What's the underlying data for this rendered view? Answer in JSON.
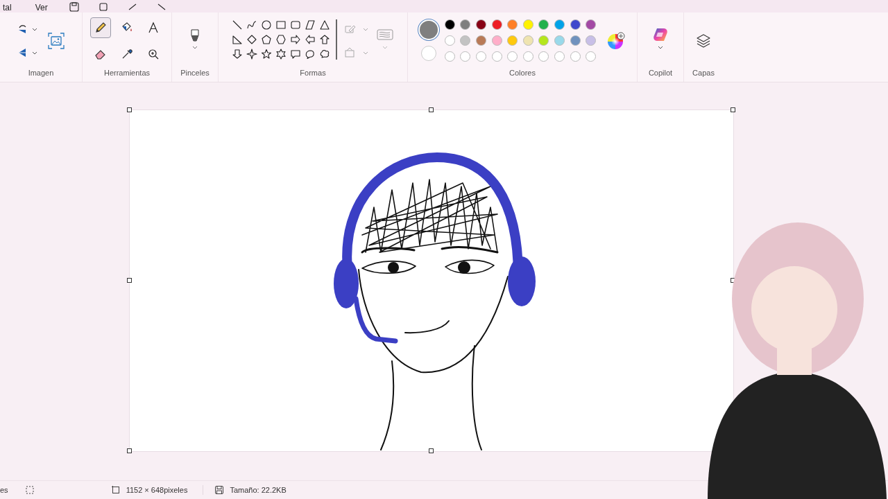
{
  "menu": [
    {
      "label": "tal"
    },
    {
      "label": "Ver"
    }
  ],
  "ribbon": {
    "image": {
      "label": "Imagen"
    },
    "tools": {
      "label": "Herramientas",
      "items": [
        {
          "kind": "pencil",
          "selected": true
        },
        {
          "kind": "fill",
          "selected": false
        },
        {
          "kind": "text",
          "selected": false
        },
        {
          "kind": "eraser",
          "selected": false
        },
        {
          "kind": "picker",
          "selected": false
        },
        {
          "kind": "zoom",
          "selected": false
        }
      ]
    },
    "brushes": {
      "label": "Pinceles"
    },
    "shapes": {
      "label": "Formas",
      "items": [
        {
          "kind": "line"
        },
        {
          "kind": "curve"
        },
        {
          "kind": "oval"
        },
        {
          "kind": "rect"
        },
        {
          "kind": "roundrect"
        },
        {
          "kind": "polygon"
        },
        {
          "kind": "triangle"
        },
        {
          "kind": "right-triangle"
        },
        {
          "kind": "diamond"
        },
        {
          "kind": "pentagon"
        },
        {
          "kind": "hexagon"
        },
        {
          "kind": "arrow-right"
        },
        {
          "kind": "arrow-left"
        },
        {
          "kind": "arrow-up"
        },
        {
          "kind": "arrow-down"
        },
        {
          "kind": "star4"
        },
        {
          "kind": "star5"
        },
        {
          "kind": "star6"
        },
        {
          "kind": "callout-rect"
        },
        {
          "kind": "callout-oval"
        },
        {
          "kind": "callout-cloud"
        }
      ]
    },
    "colors": {
      "label": "Colores",
      "current": [
        {
          "color": "#7f7f7f",
          "selected": true
        },
        {
          "color": "#ffffff",
          "selected": false
        }
      ],
      "palette": [
        {
          "kind": "swatch",
          "color": "#000000"
        },
        {
          "kind": "swatch",
          "color": "#7f7f7f"
        },
        {
          "kind": "swatch",
          "color": "#880015"
        },
        {
          "kind": "swatch",
          "color": "#ed1c24"
        },
        {
          "kind": "swatch",
          "color": "#ff7f27"
        },
        {
          "kind": "swatch",
          "color": "#fff200"
        },
        {
          "kind": "swatch",
          "color": "#22b14c"
        },
        {
          "kind": "swatch",
          "color": "#00a2e8"
        },
        {
          "kind": "swatch",
          "color": "#3f48cc"
        },
        {
          "kind": "swatch",
          "color": "#a349a4"
        },
        {
          "kind": "swatch",
          "color": "#ffffff"
        },
        {
          "kind": "swatch",
          "color": "#c3c3c3"
        },
        {
          "kind": "swatch",
          "color": "#b97a57"
        },
        {
          "kind": "swatch",
          "color": "#ffaec9"
        },
        {
          "kind": "swatch",
          "color": "#ffc90e"
        },
        {
          "kind": "swatch",
          "color": "#efe4b0"
        },
        {
          "kind": "swatch",
          "color": "#b5e61d"
        },
        {
          "kind": "swatch",
          "color": "#99d9ea"
        },
        {
          "kind": "swatch",
          "color": "#7092be"
        },
        {
          "kind": "swatch",
          "color": "#c8bfe7"
        },
        {
          "kind": "empty"
        },
        {
          "kind": "empty"
        },
        {
          "kind": "empty"
        },
        {
          "kind": "empty"
        },
        {
          "kind": "empty"
        },
        {
          "kind": "empty"
        },
        {
          "kind": "empty"
        },
        {
          "kind": "empty"
        },
        {
          "kind": "empty"
        },
        {
          "kind": "empty"
        }
      ]
    },
    "copilot": {
      "label": "Copilot"
    },
    "layers": {
      "label": "Capas"
    }
  },
  "status": {
    "left": "es",
    "dimensions": "1152 × 648pixeles",
    "size": "Tamaño: 22.2KB"
  }
}
